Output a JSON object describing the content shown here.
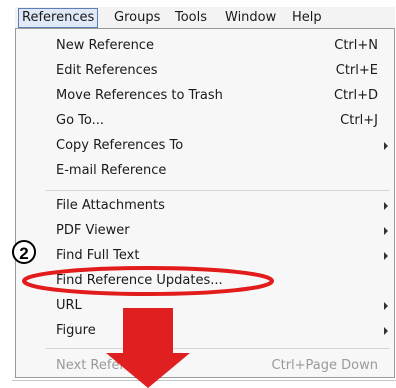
{
  "menubar": {
    "items": [
      "References",
      "Groups",
      "Tools",
      "Window",
      "Help"
    ]
  },
  "menu": {
    "items": [
      {
        "label": "New Reference",
        "shortcut": "Ctrl+N"
      },
      {
        "label": "Edit References",
        "shortcut": "Ctrl+E"
      },
      {
        "label": "Move References to Trash",
        "shortcut": "Ctrl+D"
      },
      {
        "label": "Go To...",
        "shortcut": "Ctrl+J"
      },
      {
        "label": "Copy References To",
        "submenu": true
      },
      {
        "label": "E-mail Reference"
      },
      {
        "label": "File Attachments",
        "submenu": true
      },
      {
        "label": "PDF Viewer",
        "submenu": true
      },
      {
        "label": "Find Full Text",
        "submenu": true
      },
      {
        "label": "Find Reference Updates..."
      },
      {
        "label": "URL",
        "submenu": true
      },
      {
        "label": "Figure",
        "submenu": true
      },
      {
        "label": "Next Reference",
        "shortcut": "Ctrl+Page Down"
      }
    ]
  },
  "annotation": {
    "step_number": "2",
    "highlight_color": "#e21b1b",
    "arrow_color": "#e02020"
  }
}
